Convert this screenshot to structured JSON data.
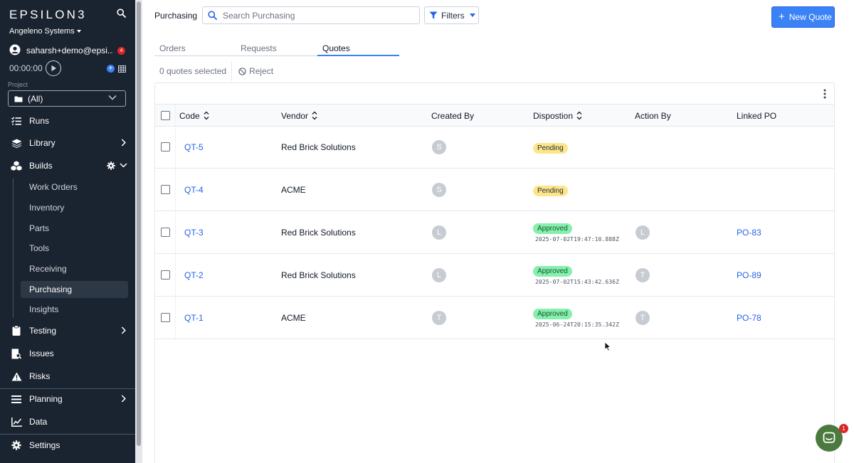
{
  "sidebar": {
    "logo": "EPSILON3",
    "org": "Angeleno Systems",
    "user": "saharsh+demo@epsi...",
    "notification_count": "4",
    "timer": "00:00:00",
    "project_label": "Project",
    "project_value": "(All)",
    "nav": {
      "runs": "Runs",
      "library": "Library",
      "builds": "Builds",
      "testing": "Testing",
      "issues": "Issues",
      "risks": "Risks",
      "planning": "Planning",
      "data": "Data",
      "settings": "Settings"
    },
    "builds_sub": [
      "Work Orders",
      "Inventory",
      "Parts",
      "Tools",
      "Receiving",
      "Purchasing",
      "Insights"
    ],
    "active_sub": "Purchasing"
  },
  "header": {
    "title": "Purchasing",
    "search_placeholder": "Search Purchasing",
    "filters_label": "Filters",
    "new_quote_label": "New Quote"
  },
  "tabs": [
    "Orders",
    "Requests",
    "Quotes"
  ],
  "active_tab": "Quotes",
  "toolbar": {
    "selected_text": "0 quotes selected",
    "reject_label": "Reject"
  },
  "table": {
    "columns": {
      "code": "Code",
      "vendor": "Vendor",
      "created_by": "Created By",
      "disposition": "Dispostion",
      "action_by": "Action By",
      "linked_po": "Linked PO"
    },
    "rows": [
      {
        "code": "QT-5",
        "vendor": "Red Brick Solutions",
        "created_by": "S",
        "status": "Pending",
        "timestamp": "",
        "action_by": "",
        "linked_po": ""
      },
      {
        "code": "QT-4",
        "vendor": "ACME",
        "created_by": "S",
        "status": "Pending",
        "timestamp": "",
        "action_by": "",
        "linked_po": ""
      },
      {
        "code": "QT-3",
        "vendor": "Red Brick Solutions",
        "created_by": "L",
        "status": "Approved",
        "timestamp": "2025-07-02T19:47:10.888Z",
        "action_by": "L",
        "linked_po": "PO-83"
      },
      {
        "code": "QT-2",
        "vendor": "Red Brick Solutions",
        "created_by": "L",
        "status": "Approved",
        "timestamp": "2025-07-02T15:43:42.636Z",
        "action_by": "T",
        "linked_po": "PO-89"
      },
      {
        "code": "QT-1",
        "vendor": "ACME",
        "created_by": "T",
        "status": "Approved",
        "timestamp": "2025-06-24T20:15:35.342Z",
        "action_by": "T",
        "linked_po": "PO-78"
      }
    ]
  },
  "chat_badge": "1",
  "colors": {
    "sidebar_bg": "#1a2330",
    "accent": "#3b82f6",
    "link": "#2563eb",
    "pending": "#fde68a",
    "approved": "#86efac"
  }
}
